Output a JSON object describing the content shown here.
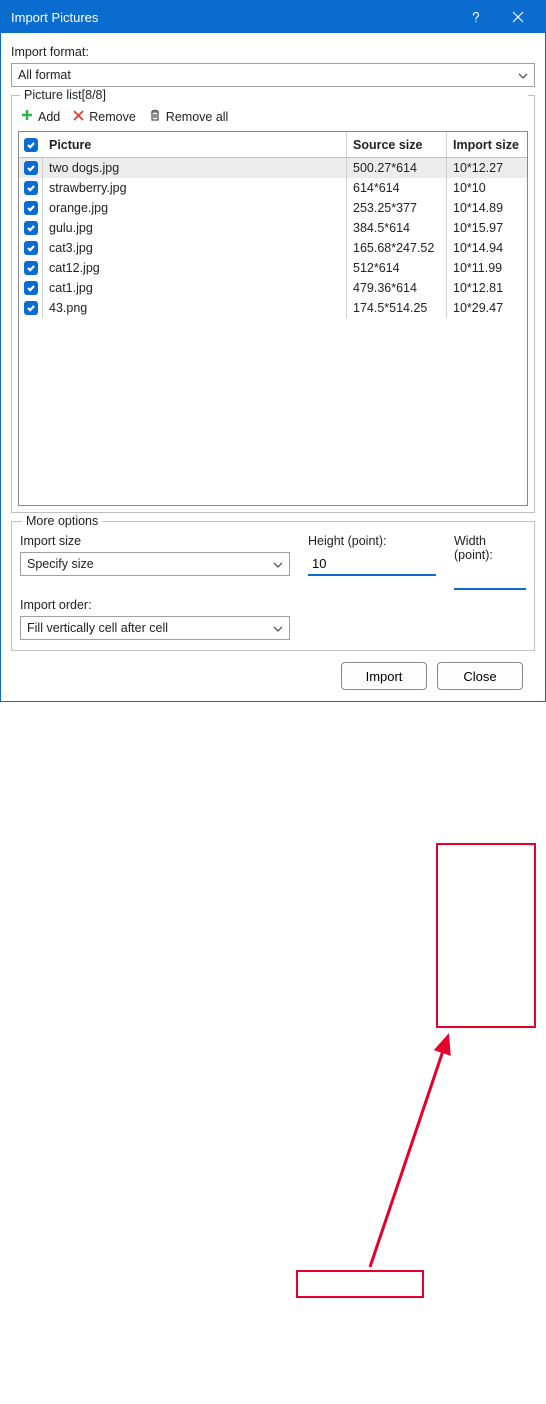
{
  "window": {
    "title": "Import Pictures"
  },
  "import_format": {
    "label": "Import format:",
    "value": "All format"
  },
  "picture_list": {
    "legend": "Picture list[8/8]",
    "toolbar": {
      "add": "Add",
      "remove": "Remove",
      "remove_all": "Remove all"
    },
    "headers": {
      "picture": "Picture",
      "source_size": "Source size",
      "import_size": "Import size"
    },
    "rows": [
      {
        "checked": true,
        "picture": "two dogs.jpg",
        "source": "500.27*614",
        "import": "10*12.27",
        "selected": true
      },
      {
        "checked": true,
        "picture": "strawberry.jpg",
        "source": "614*614",
        "import": "10*10"
      },
      {
        "checked": true,
        "picture": "orange.jpg",
        "source": "253.25*377",
        "import": "10*14.89"
      },
      {
        "checked": true,
        "picture": "gulu.jpg",
        "source": "384.5*614",
        "import": "10*15.97"
      },
      {
        "checked": true,
        "picture": "cat3.jpg",
        "source": "165.68*247.52",
        "import": "10*14.94"
      },
      {
        "checked": true,
        "picture": "cat12.jpg",
        "source": "512*614",
        "import": "10*11.99"
      },
      {
        "checked": true,
        "picture": "cat1.jpg",
        "source": "479.36*614",
        "import": "10*12.81"
      },
      {
        "checked": true,
        "picture": "43.png",
        "source": "174.5*514.25",
        "import": "10*29.47"
      }
    ]
  },
  "more_options": {
    "legend": "More options",
    "import_size": {
      "label": "Import size",
      "value": "Specify size"
    },
    "height": {
      "label": "Height (point):",
      "value": "10"
    },
    "width": {
      "label": "Width (point):",
      "value": ""
    },
    "import_order": {
      "label": "Import order:",
      "value": "Fill vertically cell after cell"
    }
  },
  "footer": {
    "import": "Import",
    "close": "Close"
  }
}
